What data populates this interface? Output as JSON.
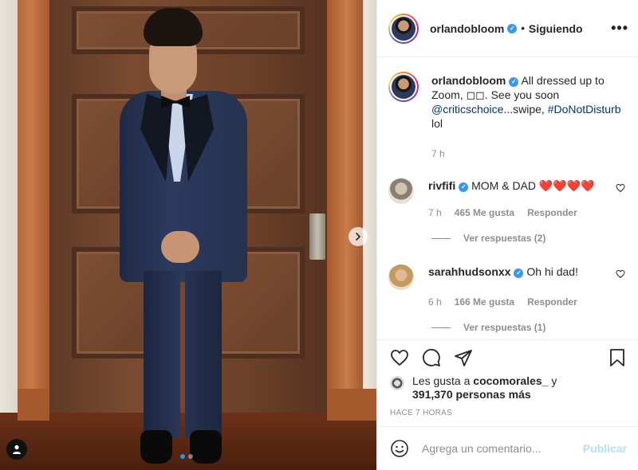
{
  "header": {
    "username": "orlandobloom",
    "separator": "•",
    "follow_status": "Siguiendo",
    "more": "•••"
  },
  "caption": {
    "username": "orlandobloom",
    "text_before": "All dressed up to Zoom, ◻◻. See you soon",
    "mention": "@criticschoice",
    "text_middle": "...swipe,",
    "hashtag": "#DoNotDisturb",
    "text_after": " lol",
    "time": "7 h"
  },
  "comments": [
    {
      "username": "rivfifi",
      "text": "MOM & DAD ❤️❤️❤️❤️",
      "time": "7 h",
      "likes": "465 Me gusta",
      "reply": "Responder",
      "view_replies": "Ver respuestas (2)"
    },
    {
      "username": "sarahhudsonxx",
      "text": "Oh hi dad!",
      "time": "6 h",
      "likes": "166 Me gusta",
      "reply": "Responder",
      "view_replies": "Ver respuestas (1)"
    }
  ],
  "likes": {
    "prefix": "Les gusta a ",
    "user": "cocomorales_",
    "suffix": " y",
    "count": "391,370 personas más"
  },
  "timestamp": "HACE 7 HORAS",
  "comment_box": {
    "placeholder": "Agrega un comentario...",
    "publish": "Publicar"
  },
  "colors": {
    "verified": "#3897f0",
    "link": "#00376b",
    "publish_disabled": "#b2dffc",
    "carousel_active": "#2196f3"
  }
}
